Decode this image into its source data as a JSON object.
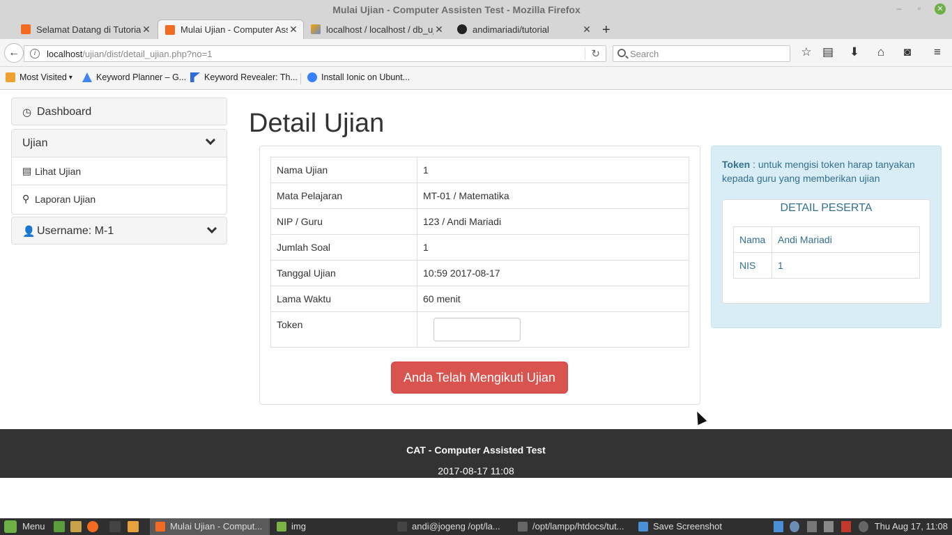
{
  "window": {
    "title": "Mulai Ujian - Computer Assisten Test - Mozilla Firefox"
  },
  "tabs": [
    {
      "label": "Selamat Datang di Tutorial",
      "active": false
    },
    {
      "label": "Mulai Ujian - Computer Assisten Test",
      "active": true
    },
    {
      "label": "localhost / localhost / db_ujian",
      "active": false
    },
    {
      "label": "andimariadi/tutorial",
      "active": false
    }
  ],
  "address": {
    "host": "localhost",
    "path": "/ujian/dist/detail_ujian.php?no=1"
  },
  "search": {
    "placeholder": "Search"
  },
  "bookmarks": [
    {
      "label": "Most Visited"
    },
    {
      "label": "Keyword Planner – G..."
    },
    {
      "label": "Keyword Revealer: Th..."
    },
    {
      "label": "Install Ionic on Ubunt..."
    }
  ],
  "sidebar": {
    "dashboard": "Dashboard",
    "ujian": "Ujian",
    "lihat_ujian": "Lihat Ujian",
    "laporan_ujian": "Laporan Ujian",
    "username": "Username: M-1"
  },
  "page": {
    "title": "Detail Ujian"
  },
  "detail": {
    "rows": [
      {
        "key": "Nama Ujian",
        "value": "1"
      },
      {
        "key": "Mata Pelajaran",
        "value": "MT-01 / Matematika"
      },
      {
        "key": "NIP / Guru",
        "value": "123 / Andi Mariadi"
      },
      {
        "key": "Jumlah Soal",
        "value": "1"
      },
      {
        "key": "Tanggal Ujian",
        "value": "10:59 2017-08-17"
      },
      {
        "key": "Lama Waktu",
        "value": "60 menit"
      }
    ],
    "token_label": "Token",
    "token_value": "",
    "button": "Anda Telah Mengikuti Ujian"
  },
  "info": {
    "token_bold": "Token",
    "token_text": " : untuk mengisi token harap tanyakan kepada guru yang memberikan ujian",
    "peserta_title": "DETAIL PESERTA",
    "peserta": [
      {
        "key": "Nama",
        "value": "Andi Mariadi"
      },
      {
        "key": "NIS",
        "value": "1"
      }
    ]
  },
  "footer": {
    "title": "CAT - Computer Assisted Test",
    "datetime": "2017-08-17 11:08"
  },
  "taskbar": {
    "menu": "Menu",
    "items": [
      {
        "label": "Mulai Ujian - Comput...",
        "active": true
      },
      {
        "label": "img",
        "active": false
      },
      {
        "label": "andi@jogeng /opt/la...",
        "active": false
      },
      {
        "label": "/opt/lampp/htdocs/tut...",
        "active": false
      },
      {
        "label": "Save Screenshot",
        "active": false
      }
    ],
    "clock": "Thu Aug 17, 11:08"
  },
  "colors": {
    "danger": "#d9534f",
    "info_bg": "#d9edf7",
    "info_text": "#31708f",
    "footer_bg": "#333333"
  }
}
